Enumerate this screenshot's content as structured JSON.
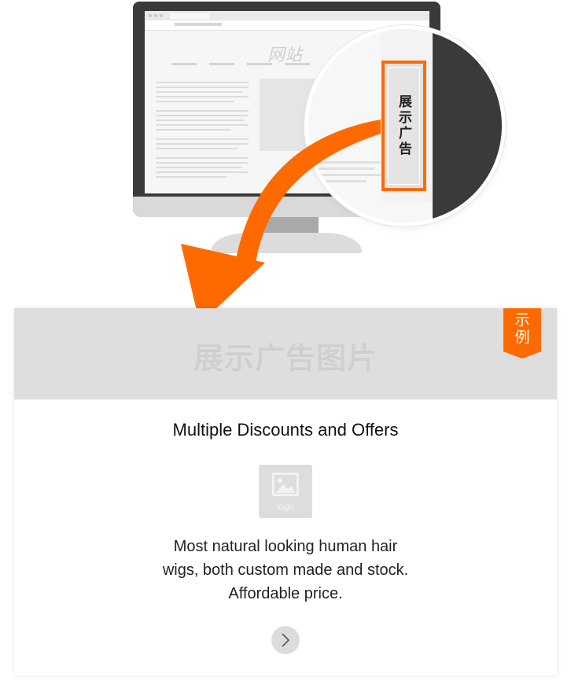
{
  "illustration": {
    "site_label": "网站",
    "ad_slot_label": "展示广告"
  },
  "card": {
    "banner_label": "展示广告图片",
    "badge_lines": [
      "示",
      "例"
    ],
    "title": "Multiple Discounts and Offers",
    "logo_label": "logo",
    "description_lines": [
      "Most natural looking human hair",
      "wigs, both custom made and stock.",
      "Affordable price."
    ]
  },
  "colors": {
    "accent": "#ff6a00",
    "banner_bg": "#dedede",
    "monitor_bezel": "#3a3a3a"
  },
  "icons": [
    "image-placeholder-icon",
    "chevron-right-icon",
    "curved-arrow"
  ]
}
